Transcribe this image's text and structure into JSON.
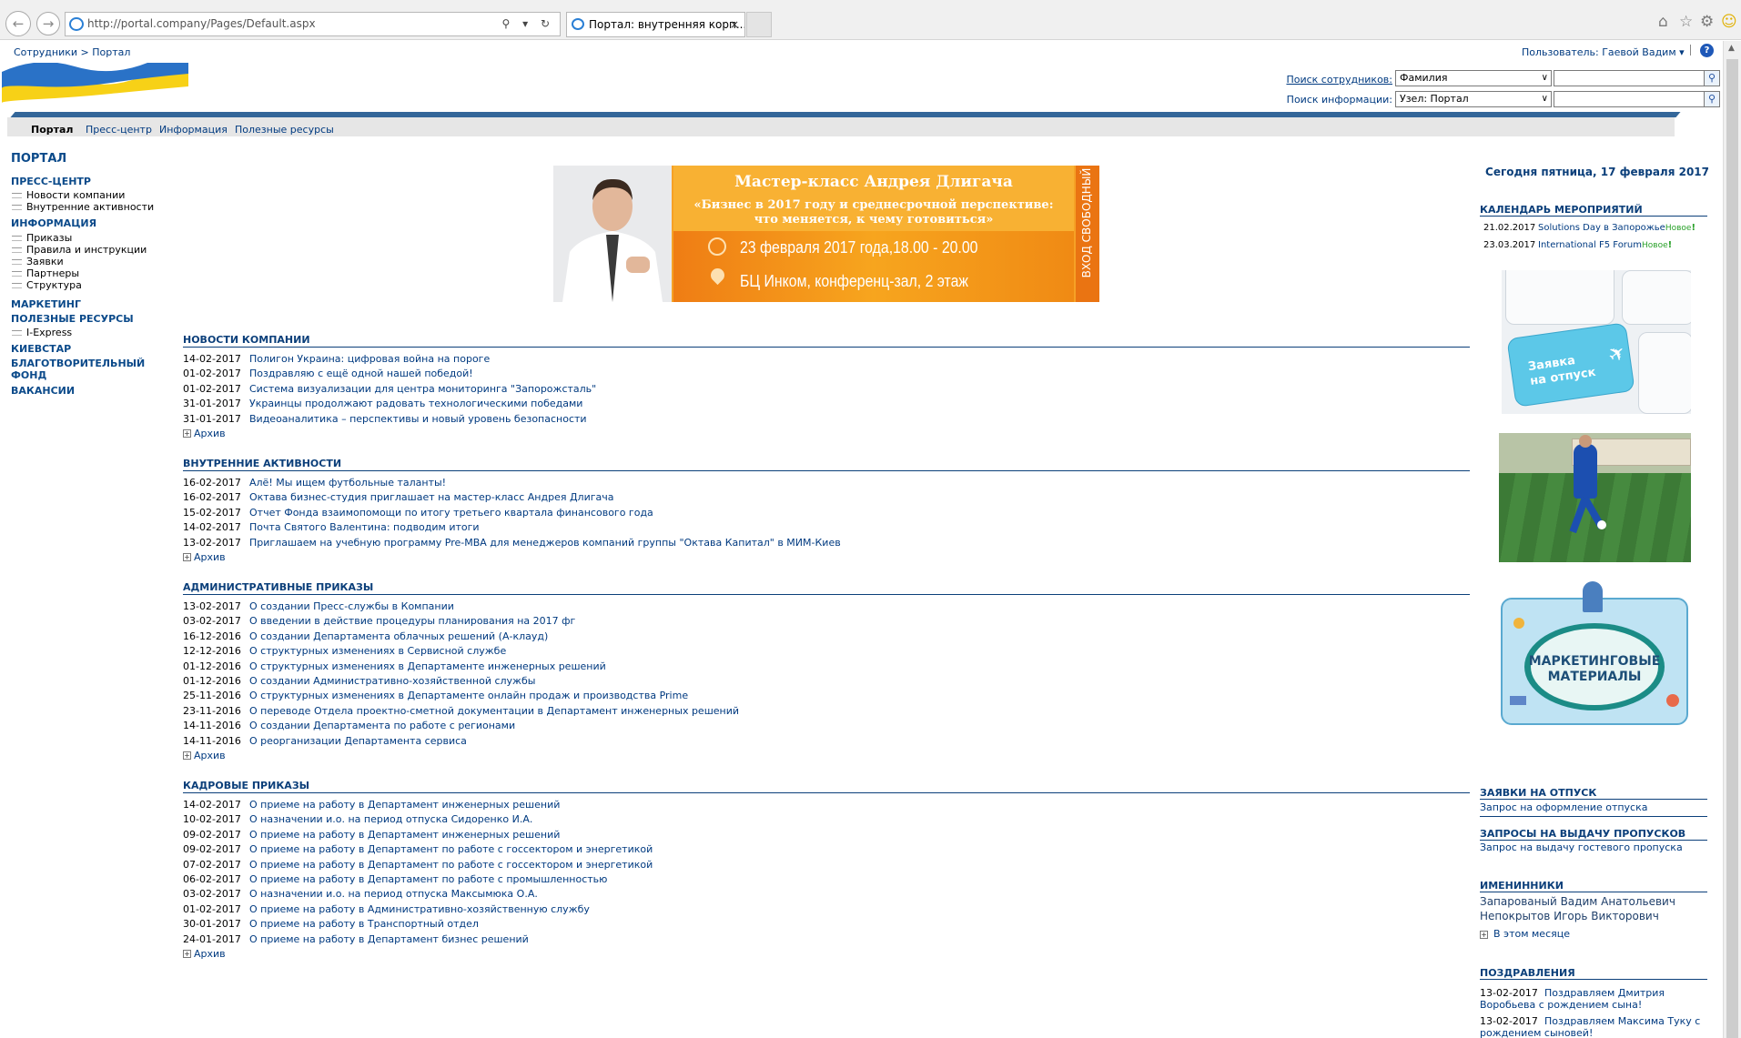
{
  "browser": {
    "url": "http://portal.company/Pages/Default.aspx",
    "tab_title": "Портал: внутренняя корп...",
    "tab_close": "×"
  },
  "header": {
    "breadcrumb": "Сотрудники > Портал",
    "user_label": "Пользователь: Гаевой Вадим ▾",
    "help": "?",
    "employee_search_label": "Поиск сотрудников:",
    "employee_search_option": "Фамилия",
    "info_search_label": "Поиск информации:",
    "info_search_option": "Узел: Портал"
  },
  "menu": {
    "items": [
      "Портал",
      "Пресс-центр",
      "Информация",
      "Полезные ресурсы"
    ]
  },
  "left_nav": {
    "title": "ПОРТАЛ",
    "press_center": "ПРЕСС-ЦЕНТР",
    "press_items": [
      "Новости компании",
      "Внутренние активности"
    ],
    "information": "ИНФОРМАЦИЯ",
    "info_items": [
      "Приказы",
      "Правила и инструкции",
      "Заявки",
      "Партнеры",
      "Структура"
    ],
    "marketing": "МАРКЕТИНГ",
    "useful": "ПОЛЕЗНЫЕ РЕСУРСЫ",
    "useful_items": [
      "I-Express"
    ],
    "kyivstar": "КИЕВСТАР",
    "charity_1": "БЛАГОТВОРИТЕЛЬНЫЙ",
    "charity_2": "ФОНД",
    "vacancies": "ВАКАНСИИ"
  },
  "banner": {
    "title": "Мастер-класс Андрея Длигача",
    "subtitle_1": "«Бизнес в 2017 году и среднесрочной перспективе:",
    "subtitle_2": "что меняется, к чему готовиться»",
    "datetime": "23 февраля 2017 года,18.00 - 20.00",
    "place": "БЦ Инком, конференц-зал, 2 этаж",
    "free": "ВХОД СВОБОДНЫЙ"
  },
  "archive_label": "Архив",
  "sections": [
    {
      "title": "НОВОСТИ КОМПАНИИ",
      "rows": [
        {
          "date": "14-02-2017",
          "text": "Полигон Украина: цифровая война на пороге"
        },
        {
          "date": "01-02-2017",
          "text": "Поздравляю с ещё одной нашей победой!"
        },
        {
          "date": "01-02-2017",
          "text": "Система визуализации для центра мониторинга \"Запорожсталь\""
        },
        {
          "date": "31-01-2017",
          "text": "Украинцы продолжают радовать технологическими победами"
        },
        {
          "date": "31-01-2017",
          "text": "Видеоаналитика – перспективы и новый уровень безопасности"
        }
      ]
    },
    {
      "title": "ВНУТРЕННИЕ АКТИВНОСТИ",
      "rows": [
        {
          "date": "16-02-2017",
          "text": "Алё! Мы ищем футбольные таланты!"
        },
        {
          "date": "16-02-2017",
          "text": "Октава бизнес-студия приглашает на мастер-класс Андрея Длигача"
        },
        {
          "date": "15-02-2017",
          "text": "Отчет Фонда взаимопомощи по итогу третьего квартала финансового года"
        },
        {
          "date": "14-02-2017",
          "text": "Почта Святого Валентина: подводим итоги"
        },
        {
          "date": "13-02-2017",
          "text": "Приглашаем на учебную программу Pre-MBA для менеджеров компаний группы \"Октава Капитал\" в МИМ-Киев"
        }
      ]
    },
    {
      "title": "АДМИНИСТРАТИВНЫЕ ПРИКАЗЫ",
      "rows": [
        {
          "date": "13-02-2017",
          "text": "О создании Пресс-службы в Компании"
        },
        {
          "date": "03-02-2017",
          "text": "О введении в действие процедуры планирования на 2017 фг"
        },
        {
          "date": "16-12-2016",
          "text": "О создании Департамента облачных решений (А-клауд)"
        },
        {
          "date": "12-12-2016",
          "text": "О структурных изменениях в Сервисной службе"
        },
        {
          "date": "01-12-2016",
          "text": "О структурных изменениях в Департаменте инженерных решений"
        },
        {
          "date": "01-12-2016",
          "text": "О создании Административно-хозяйственной службы"
        },
        {
          "date": "25-11-2016",
          "text": "О структурных изменениях в Департаменте онлайн продаж и производства Prime"
        },
        {
          "date": "23-11-2016",
          "text": "О переводе Отдела проектно-сметной документации в Департамент инженерных решений"
        },
        {
          "date": "14-11-2016",
          "text": "О создании Департамента по работе с регионами"
        },
        {
          "date": "14-11-2016",
          "text": "О реорганизации Департамента сервиса"
        }
      ]
    },
    {
      "title": "КАДРОВЫЕ ПРИКАЗЫ",
      "rows": [
        {
          "date": "14-02-2017",
          "text": "О приеме на работу в Департамент инженерных решений"
        },
        {
          "date": "10-02-2017",
          "text": "О назначении и.о. на период отпуска Сидоренко И.А."
        },
        {
          "date": "09-02-2017",
          "text": "О приеме на работу в Департамент инженерных решений"
        },
        {
          "date": "09-02-2017",
          "text": "О приеме на работу в Департамент по работе с госсектором и энергетикой"
        },
        {
          "date": "07-02-2017",
          "text": "О приеме на работу в Департамент по работе с госсектором и энергетикой"
        },
        {
          "date": "06-02-2017",
          "text": "О приеме на работу в Департамент по работе с промышленностью"
        },
        {
          "date": "03-02-2017",
          "text": "О назначении и.о. на период отпуска Максымюка О.А."
        },
        {
          "date": "01-02-2017",
          "text": "О приеме на работу в Административно-хозяйственную службу"
        },
        {
          "date": "30-01-2017",
          "text": "О приеме на работу в Транспортный отдел"
        },
        {
          "date": "24-01-2017",
          "text": "О приеме на работу в Департамент бизнес решений"
        }
      ]
    }
  ],
  "right": {
    "today": "Сегодня пятница, 17 февраля 2017",
    "calendar_title": "КАЛЕНДАРЬ МЕРОПРИЯТИЙ",
    "calendar": [
      {
        "date": "21.02.2017",
        "text": "Solutions Day в Запорожье",
        "badge": "Новое"
      },
      {
        "date": "23.03.2017",
        "text": "International F5 Forum",
        "badge": "Новое"
      }
    ],
    "vacation_tile_1": "Заявка",
    "vacation_tile_2": "на отпуск",
    "marketing_tile_1": "МАРКЕТИНГОВЫЕ",
    "marketing_tile_2": "МАТЕРИАЛЫ",
    "vacation_title": "ЗАЯВКИ НА ОТПУСК",
    "vacation_link": "Запрос на оформление отпуска",
    "pass_title": "ЗАПРОСЫ НА ВЫДАЧУ ПРОПУСКОВ",
    "pass_link": "Запрос на выдачу гостевого пропуска",
    "birthdays_title": "ИМЕНИННИКИ",
    "birthdays": [
      "Запарованый Вадим Анатольевич",
      "Непокрытов Игорь Викторович"
    ],
    "birthdays_month": "В этом месяце",
    "congrats_title": "ПОЗДРАВЛЕНИЯ",
    "congrats": [
      {
        "date": "13-02-2017",
        "line1": "Поздравляем Дмитрия",
        "line2": "Воробьева с рождением сына!"
      },
      {
        "date": "13-02-2017",
        "line1": "Поздравляем Максима Туку с",
        "line2": "рождением сыновей!"
      }
    ]
  }
}
